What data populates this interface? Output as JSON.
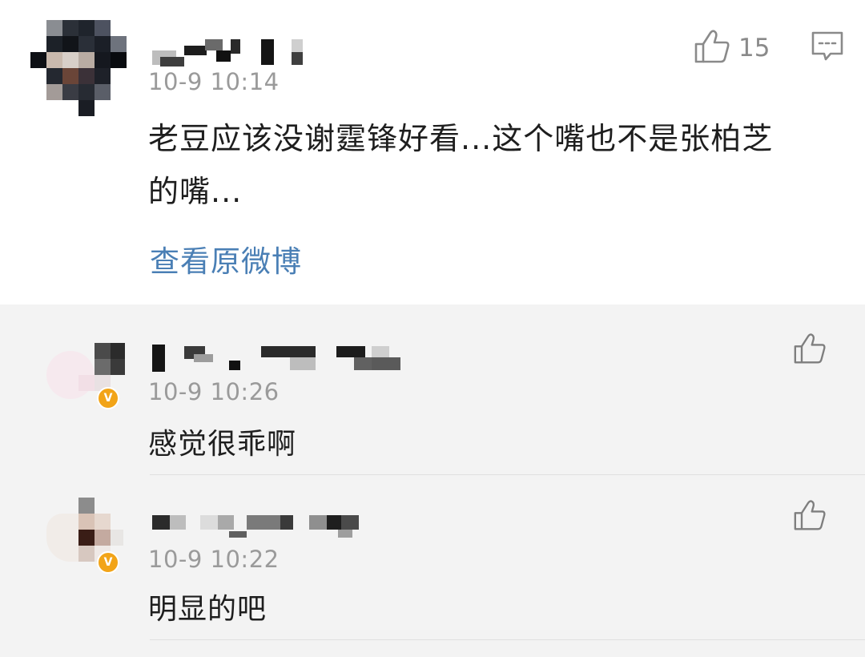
{
  "main_comment": {
    "time": "10-9 10:14",
    "like_count": "15",
    "text_line1": "老豆应该没谢霆锋好看...这个嘴也不是张柏芝",
    "text_line2": "的嘴...",
    "view_original_label": "查看原微博",
    "like_icon": "thumbs-up-icon",
    "reply_icon": "comment-bubble-icon"
  },
  "replies": [
    {
      "time": "10-9 10:26",
      "text": "感觉很乖啊",
      "verified": true,
      "like_icon": "thumbs-up-icon"
    },
    {
      "time": "10-9 10:22",
      "text": "明显的吧",
      "verified": true,
      "like_icon": "thumbs-up-icon"
    }
  ],
  "colors": {
    "link": "#4a7fb5",
    "time": "#9a9a9a",
    "reply_background": "#f3f3f3",
    "verified_badge": "#f2a418"
  }
}
